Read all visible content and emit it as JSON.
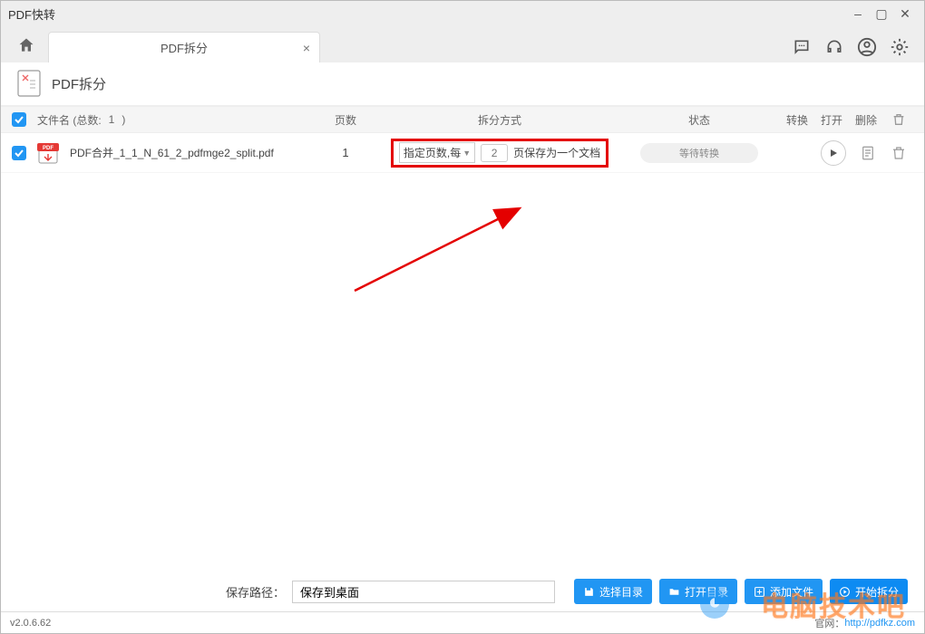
{
  "window": {
    "title": "PDF快转"
  },
  "tab": {
    "title": "PDF拆分"
  },
  "subheader": {
    "title": "PDF拆分"
  },
  "list": {
    "total_label_prefix": "文件名 (总数:",
    "total_count": "1",
    "total_label_suffix": ")",
    "head_pages": "页数",
    "head_mode": "拆分方式",
    "head_status": "状态",
    "head_convert": "转换",
    "head_open": "打开",
    "head_delete": "删除"
  },
  "row": {
    "filename": "PDF合并_1_1_N_61_2_pdfmge2_split.pdf",
    "pages": "1",
    "mode_select": "指定页数,每",
    "num_placeholder": "2",
    "after_text": "页保存为一个文档",
    "status": "等待转换"
  },
  "footer": {
    "label": "保存路径：",
    "path_value": "保存到桌面",
    "btn_choose": "选择目录",
    "btn_open": "打开目录",
    "btn_add": "添加文件",
    "btn_start": "开始拆分"
  },
  "status": {
    "version": "v2.0.6.62",
    "site_label": "官网：",
    "site_url": "http://pdfkz.com"
  },
  "watermark": "电脑技术吧"
}
